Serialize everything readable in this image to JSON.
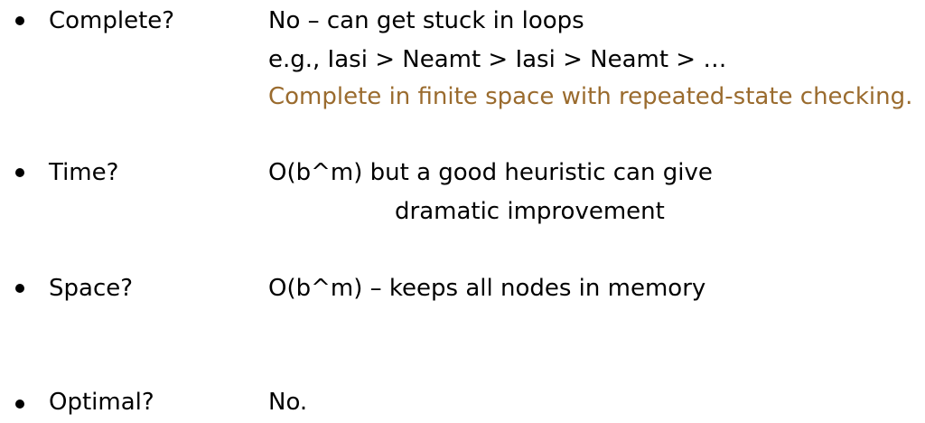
{
  "properties": [
    {
      "label": "Complete?",
      "lines": [
        "No – can get stuck in loops",
        "e.g., Iasi > Neamt > Iasi > Neamt > …",
        "Complete in finite space with repeated-state checking."
      ]
    },
    {
      "label": "Time?",
      "lines": [
        "O(b^m) but a good heuristic can give",
        "dramatic improvement"
      ]
    },
    {
      "label": "Space?",
      "lines": [
        "O(b^m) – keeps all nodes in memory"
      ]
    },
    {
      "label": "Optimal?",
      "lines": [
        "No."
      ]
    }
  ],
  "colors": {
    "text": "#000000",
    "highlight": "#9a6b2e"
  }
}
